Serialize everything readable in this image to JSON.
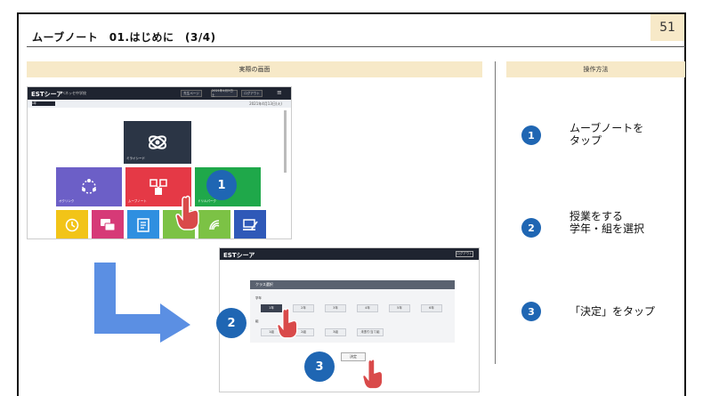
{
  "page": {
    "number": "51",
    "title": "ムーブノート　01.はじめに　(3/4)"
  },
  "bands": {
    "left": "実際の画面",
    "right": "操作方法"
  },
  "screen1": {
    "logo": "ESTシーア",
    "school": "ベネッセ中学校",
    "pills": [
      "先生ページ",
      "2021年4月3日 土",
      "ログアウト"
    ],
    "menu_icon": "≡",
    "selector": "1年",
    "date": "2021年4月13日(火)",
    "tiles": [
      {
        "caption": "ミライシード",
        "color": "#2b3545",
        "icon": "atom-icon"
      },
      {
        "caption": "オクリンク",
        "color": "#6c5fc7",
        "icon": "network-icon"
      },
      {
        "caption": "ムーブノート",
        "color": "#e53946",
        "icon": "movenote-icon"
      },
      {
        "caption": "ドリルパーク",
        "color": "#1fa84a",
        "icon": "drill-icon"
      },
      {
        "caption": "",
        "color": "#f2c418",
        "icon": "clock-icon"
      },
      {
        "caption": "",
        "color": "#d63a77",
        "icon": "chat-icon"
      },
      {
        "caption": "",
        "color": "#2f8fe0",
        "icon": "doc-icon"
      },
      {
        "caption": "",
        "color": "#7cc245",
        "icon": "hand-icon"
      },
      {
        "caption": "",
        "color": "#2f59b8",
        "icon": "pc-icon"
      }
    ]
  },
  "screen2": {
    "logo": "ESTシーア",
    "top_button": "ログアウト",
    "panel_title": "クラス選択",
    "grade_label": "学年",
    "class_label": "組",
    "grades": [
      "1年",
      "2年",
      "3年",
      "4年",
      "5年",
      "6年"
    ],
    "classes": [
      "1組",
      "2組",
      "3組",
      "未割り当て組"
    ],
    "decide_label": "決定"
  },
  "steps": [
    {
      "number": "1",
      "text_lines": [
        "ムーブノートを",
        "タップ"
      ]
    },
    {
      "number": "2",
      "text_lines": [
        "授業をする",
        "学年・組を選択"
      ]
    },
    {
      "number": "3",
      "text_lines": [
        "「決定」をタップ"
      ]
    }
  ],
  "colors": {
    "badge": "#1f66b3",
    "band": "#f7e9c8",
    "arrow": "#5b8fe3",
    "hand": "#d94a4a"
  }
}
